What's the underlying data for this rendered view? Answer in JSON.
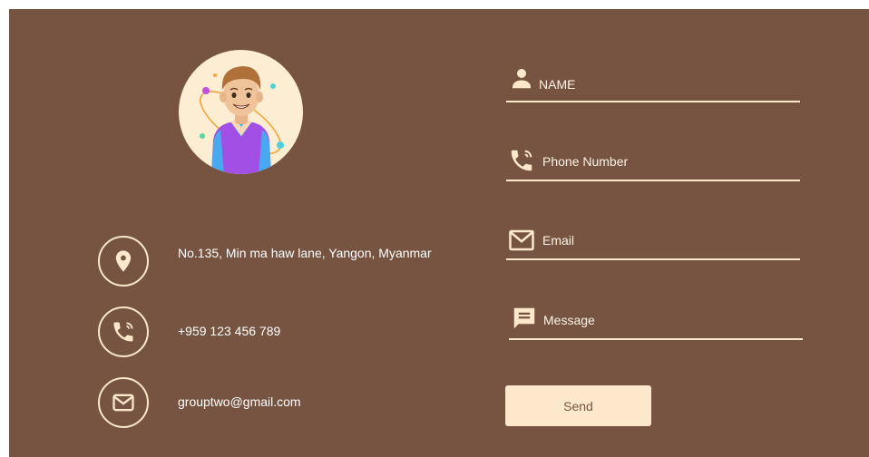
{
  "contact": {
    "address": "No.135, Min ma haw lane, Yangon, Myanmar",
    "phone": "+959 123 456 789",
    "email": "grouptwo@gmail.com"
  },
  "form": {
    "name_placeholder": "NAME",
    "phone_placeholder": "Phone Number",
    "email_placeholder": "Email",
    "message_placeholder": "Message",
    "send_label": "Send"
  },
  "icons": {
    "avatar": "avatar-illustration",
    "address": "location-pin-icon",
    "phone": "phone-ringing-icon",
    "email": "envelope-icon",
    "name_field": "person-icon",
    "phone_field": "phone-ringing-icon",
    "email_field": "envelope-icon",
    "message_field": "message-icon"
  },
  "colors": {
    "background": "#765441",
    "accent": "#fde8cc",
    "text": "#ffffff"
  }
}
